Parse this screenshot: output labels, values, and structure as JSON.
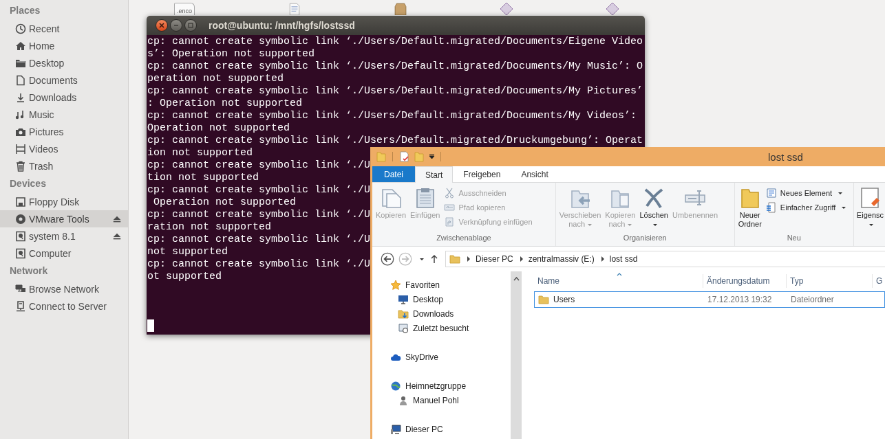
{
  "file_manager": {
    "sidebar": {
      "sections": [
        {
          "heading": "Places",
          "items": [
            {
              "label": "Recent",
              "selected": false,
              "ejectable": false
            },
            {
              "label": "Home",
              "selected": false,
              "ejectable": false
            },
            {
              "label": "Desktop",
              "selected": false,
              "ejectable": false
            },
            {
              "label": "Documents",
              "selected": false,
              "ejectable": false
            },
            {
              "label": "Downloads",
              "selected": false,
              "ejectable": false
            },
            {
              "label": "Music",
              "selected": false,
              "ejectable": false
            },
            {
              "label": "Pictures",
              "selected": false,
              "ejectable": false
            },
            {
              "label": "Videos",
              "selected": false,
              "ejectable": false
            },
            {
              "label": "Trash",
              "selected": false,
              "ejectable": false
            }
          ]
        },
        {
          "heading": "Devices",
          "items": [
            {
              "label": "Floppy Disk",
              "selected": false,
              "ejectable": false
            },
            {
              "label": "VMware Tools",
              "selected": true,
              "ejectable": true
            },
            {
              "label": "system 8.1",
              "selected": false,
              "ejectable": true
            },
            {
              "label": "Computer",
              "selected": false,
              "ejectable": false
            }
          ]
        },
        {
          "heading": "Network",
          "items": [
            {
              "label": "Browse Network",
              "selected": false,
              "ejectable": false
            },
            {
              "label": "Connect to Server",
              "selected": false,
              "ejectable": false
            }
          ]
        }
      ]
    },
    "file_icons": [
      {
        "kind": "text",
        "label": ".enco"
      },
      {
        "kind": "document"
      },
      {
        "kind": "package"
      },
      {
        "kind": "diamond"
      },
      {
        "kind": "diamond"
      }
    ]
  },
  "terminal": {
    "title": "root@ubuntu: /mnt/hgfs/lostssd",
    "cursor_visible": true,
    "lines": [
      "cp: cannot create symbolic link ‘./Users/Default.migrated/Documents/Eigene Video",
      "s’: Operation not supported",
      "cp: cannot create symbolic link ‘./Users/Default.migrated/Documents/My Music’: O",
      "peration not supported",
      "cp: cannot create symbolic link ‘./Users/Default.migrated/Documents/My Pictures’",
      ": Operation not supported",
      "cp: cannot create symbolic link ‘./Users/Default.migrated/Documents/My Videos’:",
      "Operation not supported",
      "cp: cannot create symbolic link ‘./Users/Default.migrated/Druckumgebung’: Operat",
      "ion not supported",
      "cp: cannot create symbolic link ‘./U",
      "tion not supported",
      "cp: cannot create symbolic link ‘./U",
      " Operation not supported",
      "cp: cannot create symbolic link ‘./U",
      "ration not supported",
      "cp: cannot create symbolic link ‘./U",
      "not supported",
      "cp: cannot create symbolic link ‘./U",
      "ot supported"
    ]
  },
  "explorer": {
    "title": "lost ssd",
    "tabs": [
      {
        "label": "Datei",
        "kind": "file-menu",
        "selected": false
      },
      {
        "label": "Start",
        "kind": "tab",
        "selected": true
      },
      {
        "label": "Freigeben",
        "kind": "tab",
        "selected": false
      },
      {
        "label": "Ansicht",
        "kind": "tab",
        "selected": false
      }
    ],
    "ribbon": {
      "groups": [
        {
          "label": "Zwischenablage",
          "commands": [
            {
              "label": "Kopieren",
              "kind": "large",
              "disabled": true,
              "dropdown": false
            },
            {
              "label": "Einfügen",
              "kind": "large",
              "disabled": true,
              "dropdown": false
            },
            {
              "label": "Ausschneiden",
              "kind": "small",
              "disabled": true,
              "dropdown": false
            },
            {
              "label": "Pfad kopieren",
              "kind": "small",
              "disabled": true,
              "dropdown": false
            },
            {
              "label": "Verknüpfung einfügen",
              "kind": "small",
              "disabled": true,
              "dropdown": false
            }
          ]
        },
        {
          "label": "Organisieren",
          "commands": [
            {
              "label": "Verschieben nach",
              "kind": "large",
              "disabled": true,
              "dropdown": true
            },
            {
              "label": "Kopieren nach",
              "kind": "large",
              "disabled": true,
              "dropdown": true
            },
            {
              "label": "Löschen",
              "kind": "large",
              "disabled": false,
              "dropdown": true
            },
            {
              "label": "Umbenennen",
              "kind": "large",
              "disabled": true,
              "dropdown": false
            }
          ]
        },
        {
          "label": "Neu",
          "commands": [
            {
              "label": "Neuer Ordner",
              "kind": "large",
              "disabled": false,
              "dropdown": false
            },
            {
              "label": "Neues Element",
              "kind": "small",
              "disabled": false,
              "dropdown": true
            },
            {
              "label": "Einfacher Zugriff",
              "kind": "small",
              "disabled": false,
              "dropdown": true
            }
          ]
        },
        {
          "commands": [
            {
              "label": "Eigensc",
              "kind": "large",
              "disabled": false,
              "dropdown": true
            }
          ]
        }
      ]
    },
    "address": {
      "path": [
        "Dieser PC",
        "zentralmassiv (E:)",
        "lost ssd"
      ]
    },
    "navigation": [
      {
        "label": "Favoriten",
        "kind": "group"
      },
      {
        "label": "Desktop",
        "kind": "item"
      },
      {
        "label": "Downloads",
        "kind": "item"
      },
      {
        "label": "Zuletzt besucht",
        "kind": "item"
      },
      {
        "label": "SkyDrive",
        "kind": "group"
      },
      {
        "label": "Heimnetzgruppe",
        "kind": "group"
      },
      {
        "label": "Manuel Pohl",
        "kind": "item"
      },
      {
        "label": "Dieser PC",
        "kind": "group"
      }
    ],
    "columns": [
      "Name",
      "Änderungsdatum",
      "Typ",
      "G"
    ],
    "rows": [
      {
        "name": "Users",
        "modified": "17.12.2013 19:32",
        "type": "Dateiordner",
        "selected": true
      }
    ]
  }
}
